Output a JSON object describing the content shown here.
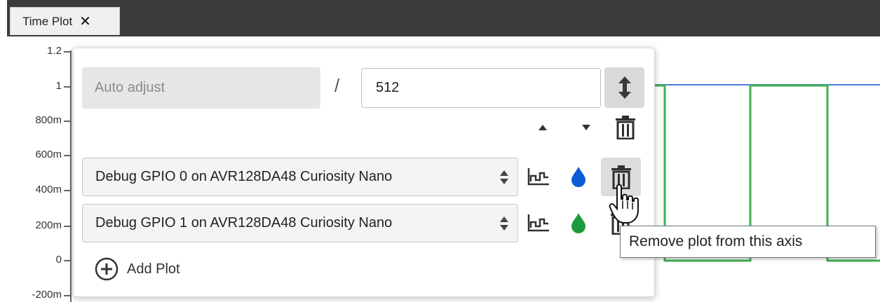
{
  "tab": {
    "title": "Time Plot",
    "close_glyph": "✕"
  },
  "y_axis": {
    "ticks": [
      "1.2",
      "1",
      "800m",
      "600m",
      "400m",
      "200m",
      "0",
      "-200m"
    ]
  },
  "axis_panel": {
    "auto_adjust_label": "Auto adjust",
    "separator": "/",
    "max_value": "512",
    "plots": [
      {
        "source": "Debug GPIO 0 on AVR128DA48 Curiosity Nano",
        "color": "#0a5cd6"
      },
      {
        "source": "Debug GPIO 1 on AVR128DA48 Curiosity Nano",
        "color": "#1f9a3a"
      }
    ],
    "add_plot_label": "Add Plot",
    "icons": [
      "vertical-resize-icon",
      "move-up-icon",
      "move-down-icon",
      "delete-axis-icon",
      "plot-style-icon",
      "color-drop-icon",
      "delete-plot-icon",
      "add-circle-icon"
    ]
  },
  "tooltip": {
    "text": "Remove plot from this axis"
  },
  "trace_colors": {
    "gpio0": "#4a7bd6",
    "gpio1": "#3fb04f"
  }
}
